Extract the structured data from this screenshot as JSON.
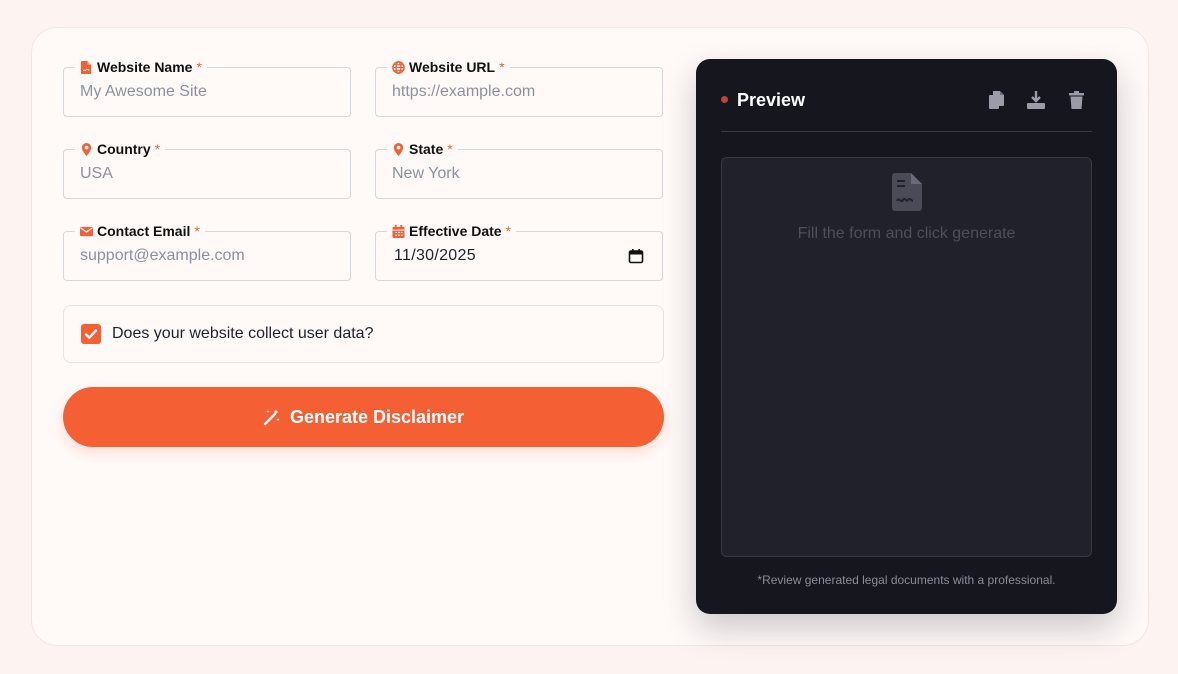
{
  "form": {
    "website_name": {
      "label": "Website Name",
      "required": "*",
      "placeholder": "My Awesome Site",
      "value": ""
    },
    "website_url": {
      "label": "Website URL",
      "required": "*",
      "placeholder": "https://example.com",
      "value": ""
    },
    "country": {
      "label": "Country",
      "required": "*",
      "placeholder": "USA",
      "value": ""
    },
    "state": {
      "label": "State",
      "required": "*",
      "placeholder": "New York",
      "value": ""
    },
    "contact_email": {
      "label": "Contact Email",
      "required": "*",
      "placeholder": "support@example.com",
      "value": ""
    },
    "effective_date": {
      "label": "Effective Date",
      "required": "*",
      "value": "11/30/2025"
    },
    "collect_data": {
      "label": "Does your website collect user data?",
      "checked": true
    },
    "generate_label": "Generate Disclaimer"
  },
  "preview": {
    "title": "Preview",
    "empty_text": "Fill the form and click generate",
    "footnote": "*Review generated legal documents with a professional."
  },
  "icons": {
    "website_name": "file-icon",
    "website_url": "globe-icon",
    "country": "map-pin-icon",
    "state": "map-pin-icon",
    "contact_email": "envelope-icon",
    "effective_date": "calendar-icon",
    "generate": "magic-wand-icon",
    "copy": "copy-icon",
    "download": "download-icon",
    "delete": "trash-icon",
    "empty": "document-icon"
  },
  "colors": {
    "accent": "#f45f34",
    "page_bg": "#fdf4f1",
    "card_bg": "#fffaf8",
    "preview_bg": "#16161e",
    "preview_area_bg": "#21212b"
  }
}
